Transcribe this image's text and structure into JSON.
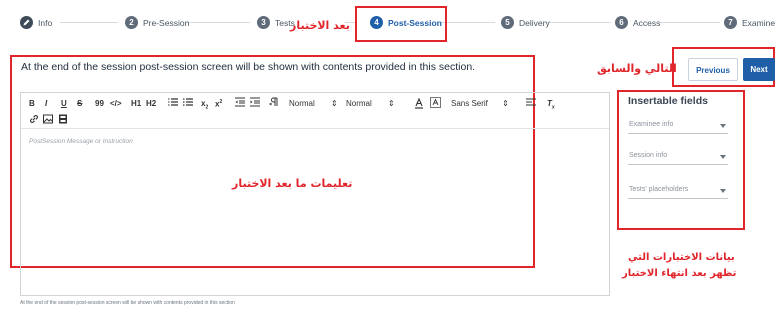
{
  "stepper": {
    "steps": [
      {
        "number": "",
        "label": "Info",
        "state": "done",
        "icon": "pencil-icon"
      },
      {
        "number": "2",
        "label": "Pre-Session",
        "state": "default"
      },
      {
        "number": "3",
        "label": "Tests",
        "state": "default"
      },
      {
        "number": "4",
        "label": "Post-Session",
        "state": "active"
      },
      {
        "number": "5",
        "label": "Delivery",
        "state": "default"
      },
      {
        "number": "6",
        "label": "Access",
        "state": "default"
      },
      {
        "number": "7",
        "label": "Examinee",
        "state": "default"
      }
    ]
  },
  "header": {
    "headline": "At the end of the session post-session screen will be shown with contents provided in this section."
  },
  "buttons": {
    "previous": "Previous",
    "next": "Next"
  },
  "editor": {
    "toolbar": {
      "bold": "B",
      "italic": "I",
      "underline": "U",
      "strike": "S",
      "quote": "99",
      "code": "</>",
      "h1": "H1",
      "h2": "H2",
      "superscript_base": "x",
      "subscript_base": "x",
      "size_label": "Normal",
      "header_label": "Normal",
      "font_label": "Sans Serif",
      "clear": "Tx"
    },
    "placeholder": "PostSession Message or Instruction"
  },
  "hint": "At the end of the session post-session screen will be shown with contents provided in this section",
  "insertable_fields": {
    "title": "Insertable fields",
    "selects": [
      "Examinee info",
      "Session info",
      "Tests' placeholders"
    ]
  },
  "annotations": {
    "post_session_note": "بعد الاختبار",
    "nav_note": "التالي والسابق",
    "editor_note": "تعليمات ما بعد الاختبار",
    "fields_note_line1": "بيانات الاختبارات التي",
    "fields_note_line2": "تظهر بعد انتهاء الاختبار"
  },
  "colors": {
    "accent": "#1f5fa8",
    "annotation_red": "#e0252b",
    "step_grey": "#5f6b78"
  }
}
